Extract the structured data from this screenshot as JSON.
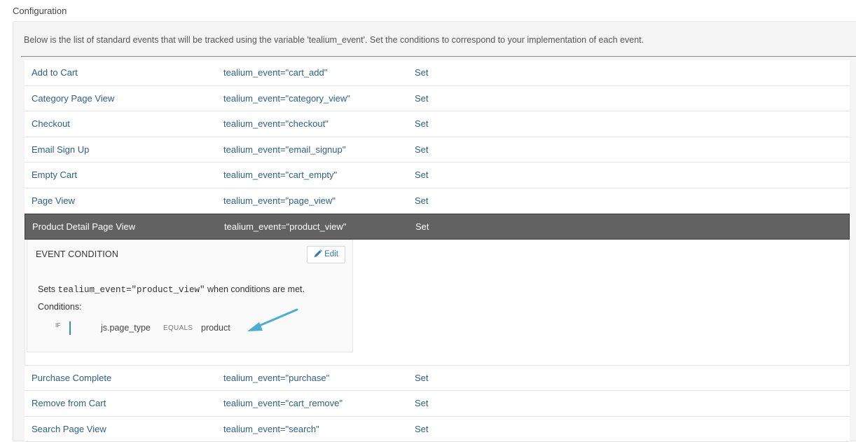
{
  "section": {
    "title": "Configuration"
  },
  "intro": "Below is the list of standard events that will be tracked using the variable 'tealium_event'. Set the conditions to correspond to your implementation of each event.",
  "events": [
    {
      "name": "Add to Cart",
      "condition": "tealium_event=\"cart_add\"",
      "action": "Set"
    },
    {
      "name": "Category Page View",
      "condition": "tealium_event=\"category_view\"",
      "action": "Set"
    },
    {
      "name": "Checkout",
      "condition": "tealium_event=\"checkout\"",
      "action": "Set"
    },
    {
      "name": "Email Sign Up",
      "condition": "tealium_event=\"email_signup\"",
      "action": "Set"
    },
    {
      "name": "Empty Cart",
      "condition": "tealium_event=\"cart_empty\"",
      "action": "Set"
    },
    {
      "name": "Page View",
      "condition": "tealium_event=\"page_view\"",
      "action": "Set"
    },
    {
      "name": "Product Detail Page View",
      "condition": "tealium_event=\"product_view\"",
      "action": "Set",
      "selected": true
    },
    {
      "name": "Purchase Complete",
      "condition": "tealium_event=\"purchase\"",
      "action": "Set"
    },
    {
      "name": "Remove from Cart",
      "condition": "tealium_event=\"cart_remove\"",
      "action": "Set"
    },
    {
      "name": "Search Page View",
      "condition": "tealium_event=\"search\"",
      "action": "Set"
    }
  ],
  "detail": {
    "title": "EVENT CONDITION",
    "edit_label": "Edit",
    "edit_icon": "pencil-icon",
    "sets_prefix": "Sets",
    "sets_code": "tealium_event=\"product_view\"",
    "sets_suffix": "when conditions are met.",
    "conditions_label": "Conditions:",
    "if_label": "IF",
    "variable": "js.page_type",
    "operator": "EQUALS",
    "value": "product",
    "arrow_icon": "arrow-pointer-icon"
  },
  "colors": {
    "link": "#2f5f85",
    "selected_row": "#626262",
    "accent": "#2e79b5",
    "arrow": "#4aaed1"
  }
}
